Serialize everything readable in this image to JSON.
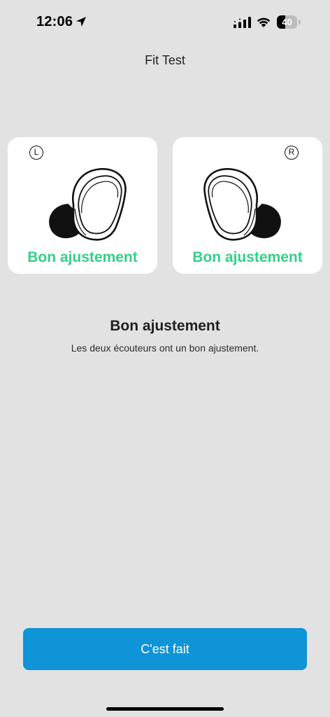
{
  "status_bar": {
    "time": "12:06",
    "battery_level": "40",
    "battery_fraction": 0.4
  },
  "header": {
    "title": "Fit Test"
  },
  "earbuds": {
    "left": {
      "side": "L",
      "status": "Bon ajustement",
      "status_color": "#34cf88",
      "icon": "earbud-left-icon"
    },
    "right": {
      "side": "R",
      "status": "Bon ajustement",
      "status_color": "#34cf88",
      "icon": "earbud-right-icon"
    }
  },
  "result": {
    "title": "Bon ajustement",
    "description": "Les deux écouteurs ont un bon ajustement."
  },
  "actions": {
    "done_label": "C'est fait",
    "done_color": "#0e94d7"
  },
  "colors": {
    "background": "#e2e2e2",
    "card": "#ffffff",
    "good_fit": "#34cf88"
  }
}
